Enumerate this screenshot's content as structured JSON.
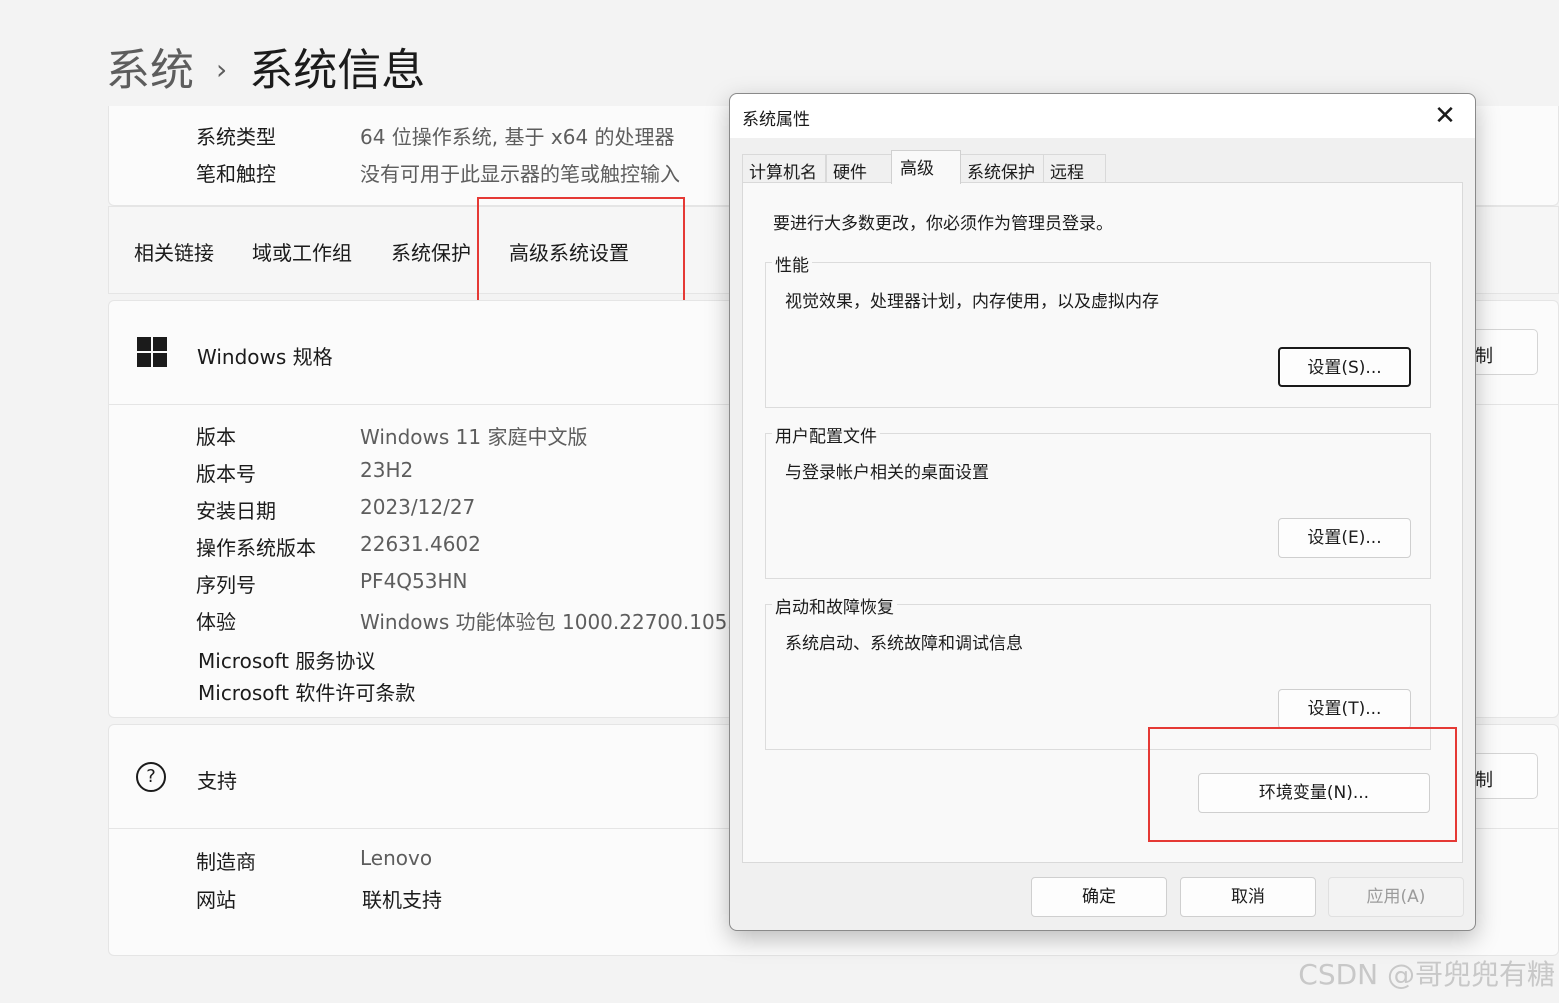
{
  "breadcrumb": {
    "parent": "系统",
    "separator": "›",
    "current": "系统信息"
  },
  "device_specs_tail": [
    {
      "label": "系统类型",
      "value": "64 位操作系统, 基于 x64 的处理器"
    },
    {
      "label": "笔和触控",
      "value": "没有可用于此显示器的笔或触控输入"
    }
  ],
  "related_links": {
    "label": "相关链接",
    "items": [
      "域或工作组",
      "系统保护",
      "高级系统设置"
    ]
  },
  "windows_specs": {
    "title": "Windows 规格",
    "copy_button": "复制",
    "rows": [
      {
        "label": "版本",
        "value": "Windows 11 家庭中文版"
      },
      {
        "label": "版本号",
        "value": "23H2"
      },
      {
        "label": "安装日期",
        "value": "2023/12/27"
      },
      {
        "label": "操作系统版本",
        "value": "22631.4602"
      },
      {
        "label": "序列号",
        "value": "PF4Q53HN"
      },
      {
        "label": "体验",
        "value": "Windows 功能体验包 1000.22700.1055.0"
      }
    ],
    "links": [
      "Microsoft 服务协议",
      "Microsoft 软件许可条款"
    ]
  },
  "support": {
    "title": "支持",
    "copy_button": "复制",
    "rows": [
      {
        "label": "制造商",
        "value": "Lenovo"
      },
      {
        "label": "网站",
        "value": "联机支持"
      }
    ]
  },
  "dialog": {
    "title": "系统属性",
    "close": "✕",
    "tabs": [
      "计算机名",
      "硬件",
      "高级",
      "系统保护",
      "远程"
    ],
    "active_tab": "高级",
    "note": "要进行大多数更改，你必须作为管理员登录。",
    "groups": [
      {
        "title": "性能",
        "desc": "视觉效果，处理器计划，内存使用，以及虚拟内存",
        "button": "设置(S)..."
      },
      {
        "title": "用户配置文件",
        "desc": "与登录帐户相关的桌面设置",
        "button": "设置(E)..."
      },
      {
        "title": "启动和故障恢复",
        "desc": "系统启动、系统故障和调试信息",
        "button": "设置(T)..."
      }
    ],
    "env_button": "环境变量(N)...",
    "ok": "确定",
    "cancel": "取消",
    "apply": "应用(A)"
  },
  "watermark": "CSDN @哥兜兜有糖",
  "colors": {
    "highlight_box": "#e53935",
    "background": "#f3f3f3"
  }
}
